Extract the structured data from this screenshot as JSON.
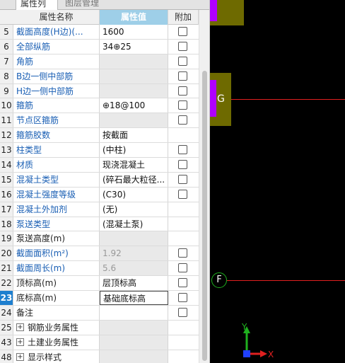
{
  "tabs": {
    "properties": "属性列表",
    "layers": "图层管理"
  },
  "header": {
    "name": "属性名称",
    "value": "属性值",
    "attach": "附加"
  },
  "rows": [
    {
      "num": "5",
      "name": "截面高度(H边)(...",
      "value": "1600",
      "check": true
    },
    {
      "num": "6",
      "name": "全部纵筋",
      "value": "34⊕25",
      "check": true
    },
    {
      "num": "7",
      "name": "角筋",
      "value": "",
      "check": true
    },
    {
      "num": "8",
      "name": "B边一侧中部筋",
      "value": "",
      "check": true
    },
    {
      "num": "9",
      "name": "H边一侧中部筋",
      "value": "",
      "check": true
    },
    {
      "num": "10",
      "name": "箍筋",
      "value": "⊕18@100",
      "check": true
    },
    {
      "num": "11",
      "name": "节点区箍筋",
      "value": "",
      "check": true
    },
    {
      "num": "12",
      "name": "箍筋胶数",
      "value": "按截面",
      "check": false
    },
    {
      "num": "13",
      "name": "柱类型",
      "value": "(中柱)",
      "check": true
    },
    {
      "num": "14",
      "name": "材质",
      "value": "现浇混凝土",
      "check": true
    },
    {
      "num": "15",
      "name": "混凝土类型",
      "value": "(碎石最大粒径...",
      "check": true
    },
    {
      "num": "16",
      "name": "混凝土强度等级",
      "value": "(C30)",
      "check": true
    },
    {
      "num": "17",
      "name": "混凝土外加剂",
      "value": "(无)",
      "check": false
    },
    {
      "num": "18",
      "name": "泵送类型",
      "value": "(混凝土泵)",
      "check": false
    },
    {
      "num": "19",
      "name": "泵送高度(m)",
      "value": "",
      "check": false
    },
    {
      "num": "20",
      "name": "截面面积(m²)",
      "value": "1.92",
      "check": true
    },
    {
      "num": "21",
      "name": "截面周长(m)",
      "value": "5.6",
      "check": true
    },
    {
      "num": "22",
      "name": "顶标高(m)",
      "value": "层顶标高",
      "check": true
    },
    {
      "num": "23",
      "name": "底标高(m)",
      "value": "基础底标高",
      "check": true
    },
    {
      "num": "24",
      "name": "备注",
      "value": "",
      "check": true
    },
    {
      "num": "25",
      "name": "钢筋业务属性",
      "value": "",
      "group": true
    },
    {
      "num": "43",
      "name": "土建业务属性",
      "value": "",
      "group": true
    },
    {
      "num": "48",
      "name": "显示样式",
      "value": "",
      "group": true
    }
  ],
  "expander_symbol": "+",
  "canvas": {
    "axis_g": "G",
    "axis_f": "F",
    "ucs_x": "X",
    "ucs_y": "Y"
  },
  "colors": {
    "header_value_bg": "#9ecfe8",
    "selected_row": "#1e7fcf",
    "label_blue": "#1a5fb4",
    "grid_red": "#e02020",
    "column_olive": "#6e6a00",
    "column_purple": "#b000ff",
    "ucs_green": "#1fb01f",
    "ucs_red": "#e02020",
    "ucs_blue": "#2040ff"
  }
}
